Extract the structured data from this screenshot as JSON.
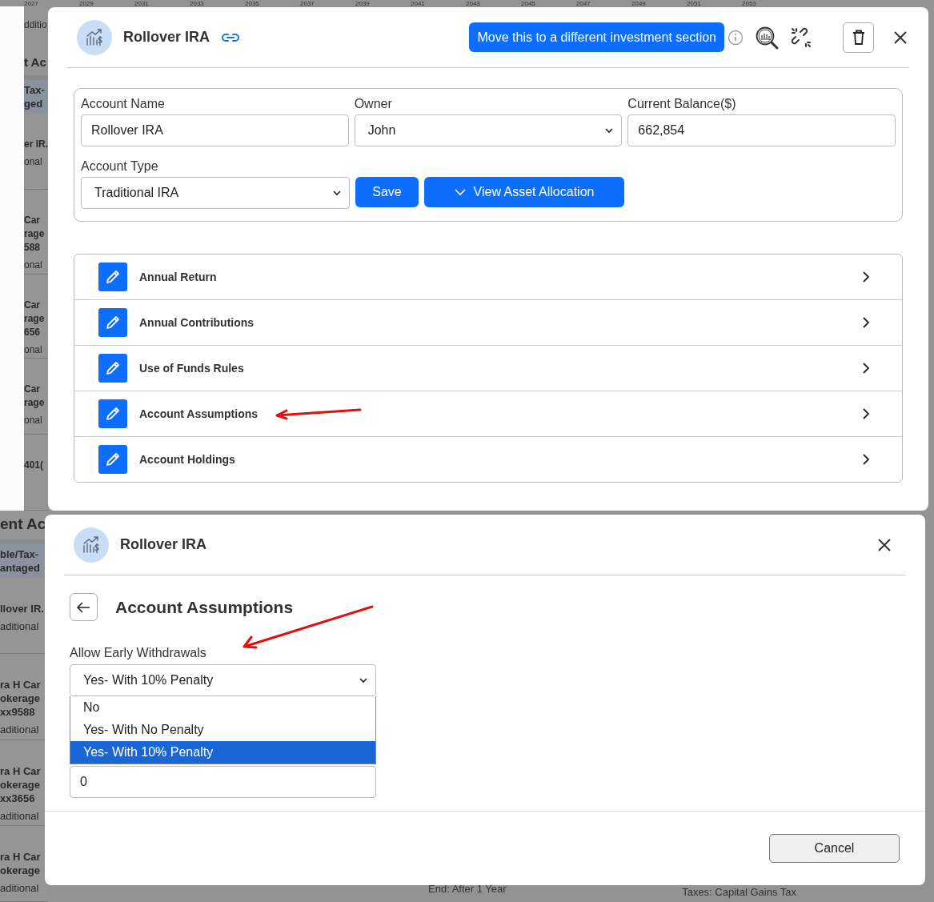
{
  "background": {
    "timeline_years": [
      "2027",
      "2029",
      "2031",
      "2033",
      "2035",
      "2037",
      "2039",
      "2041",
      "2043",
      "2045",
      "2047",
      "2049",
      "2051",
      "2053"
    ],
    "upper_column": {
      "partial_label": "dditio",
      "heading": "t Ac",
      "band": [
        "Tax-",
        "ged"
      ],
      "cards": [
        {
          "lines": [
            "er IR."
          ],
          "type": "onal"
        },
        {
          "lines": [
            "Car",
            "rage",
            "588"
          ],
          "type": "onal"
        },
        {
          "lines": [
            "Car",
            "rage",
            "656"
          ],
          "type": "onal"
        },
        {
          "lines": [
            "Car",
            "rage"
          ],
          "type": "onal"
        },
        {
          "lines": [
            "401("
          ]
        }
      ]
    },
    "lower_column": {
      "heading": "ent Ac",
      "band": [
        "ble/Tax-",
        "antaged"
      ],
      "cards": [
        {
          "lines": [
            "llover IR."
          ],
          "type": "aditional"
        },
        {
          "lines": [
            "ra H Car",
            "okerage",
            "xx9588"
          ],
          "type": "aditional"
        },
        {
          "lines": [
            "ra H Car",
            "okerage",
            "xx3656"
          ],
          "type": "aditional"
        },
        {
          "lines": [
            "ra H Car",
            "okerage"
          ],
          "type": "aditional"
        }
      ]
    },
    "bottom_texts": [
      "End: After 1 Year",
      "Taxes: Capital Gains Tax"
    ]
  },
  "account_modal": {
    "title": "Rollover IRA",
    "move_button": "Move this to a different investment section",
    "fields": [
      {
        "label": "Account Name",
        "kind": "input",
        "value": "Rollover IRA"
      },
      {
        "label": "Owner",
        "kind": "select",
        "value": "John"
      },
      {
        "label": "Current Balance($)",
        "kind": "input",
        "value": "662,854"
      }
    ],
    "account_type": {
      "label": "Account Type",
      "value": "Traditional IRA"
    },
    "save_button": "Save",
    "allocation_button": "View Asset Allocation",
    "sections": [
      {
        "label": "Annual Return",
        "marked": false
      },
      {
        "label": "Annual Contributions",
        "marked": false
      },
      {
        "label": "Use of Funds Rules",
        "marked": false
      },
      {
        "label": "Account Assumptions",
        "marked": true
      },
      {
        "label": "Account Holdings",
        "marked": false
      }
    ]
  },
  "assumptions_modal": {
    "title": "Rollover IRA",
    "heading": "Account Assumptions",
    "field": {
      "label": "Allow Early Withdrawals",
      "marked": true,
      "value": "Yes- With 10% Penalty",
      "expanded": true,
      "options": [
        {
          "label": "No",
          "selected": false
        },
        {
          "label": "Yes- With No Penalty",
          "selected": false
        },
        {
          "label": "Yes- With 10% Penalty",
          "selected": true
        }
      ]
    },
    "second_field": {
      "value": "0"
    },
    "cancel_button": "Cancel"
  }
}
